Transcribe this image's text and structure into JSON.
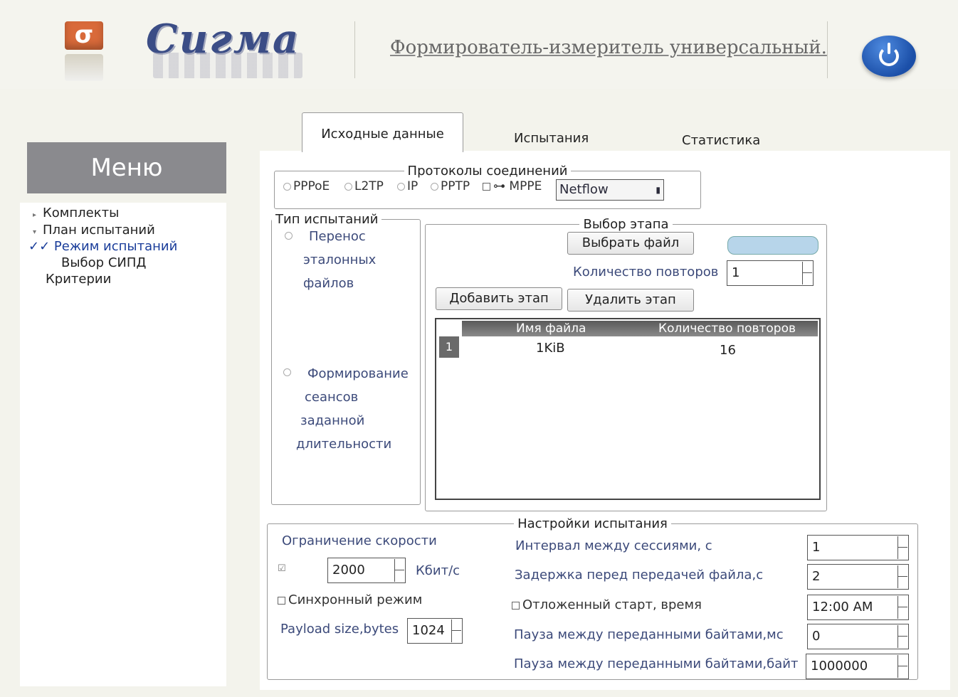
{
  "header": {
    "logo_text": "Сигма",
    "device_title": "Формирователь-измеритель универсальный."
  },
  "menu": {
    "title": "Меню",
    "items": [
      {
        "label": "Комплекты"
      },
      {
        "label": "План испытаний"
      },
      {
        "label": "Режим испытаний",
        "selected": true
      },
      {
        "label": "Выбор СИПД"
      },
      {
        "label": "Критерии"
      }
    ]
  },
  "tabs": [
    {
      "label": "Исходные данные",
      "active": true
    },
    {
      "label": "Испытания"
    },
    {
      "label": "Статистика"
    }
  ],
  "protocols": {
    "legend": "Протоколы соединений",
    "options": [
      "PPPoE",
      "L2TP",
      "IP",
      "PPTP"
    ],
    "mppe_label": "MPPE",
    "mppe_checked": false,
    "netflow_value": "Netflow"
  },
  "test_type": {
    "legend": "Тип испытаний",
    "option1": [
      "Перенос",
      "эталонных",
      "файлов"
    ],
    "option2": [
      "Формирование",
      "сеансов",
      "заданной",
      "длительности"
    ]
  },
  "stage": {
    "legend": "Выбор этапа",
    "choose_file_button": "Выбрать файл",
    "repeat_label": "Количество повторов",
    "repeat_value": "1",
    "add_button": "Добавить этап",
    "delete_button": "Удалить этап",
    "table": {
      "columns": [
        "Имя файла",
        "Количество повторов"
      ],
      "rows": [
        {
          "num": "1",
          "file": "1KiB",
          "repeats": "16"
        }
      ]
    }
  },
  "settings": {
    "legend": "Настройки испытания",
    "speed_limit_label": "Ограничение скорости",
    "speed_limit_checked": true,
    "speed_value": "2000",
    "speed_unit": "Кбит/с",
    "sync_mode_label": "Синхронный режим",
    "sync_mode_checked": false,
    "payload_label": "Payload size,bytes",
    "payload_value": "1024",
    "session_interval_label": "Интервал между сессиями, с",
    "session_interval_value": "1",
    "file_delay_label": "Задержка перед передачей файла,с",
    "file_delay_value": "2",
    "delayed_start_label": "Отложенный старт, время",
    "delayed_start_checked": false,
    "delayed_start_value": "12:00 AM",
    "pause_ms_label": "Пауза между переданными байтами,мс",
    "pause_ms_value": "0",
    "pause_bytes_label": "Пауза между переданными байтами,байт",
    "pause_bytes_value": "1000000"
  },
  "colors": {
    "accent": "#1b4fa8",
    "logo_orange": "#d96a3a",
    "menu_header": "#8a8a8e"
  }
}
